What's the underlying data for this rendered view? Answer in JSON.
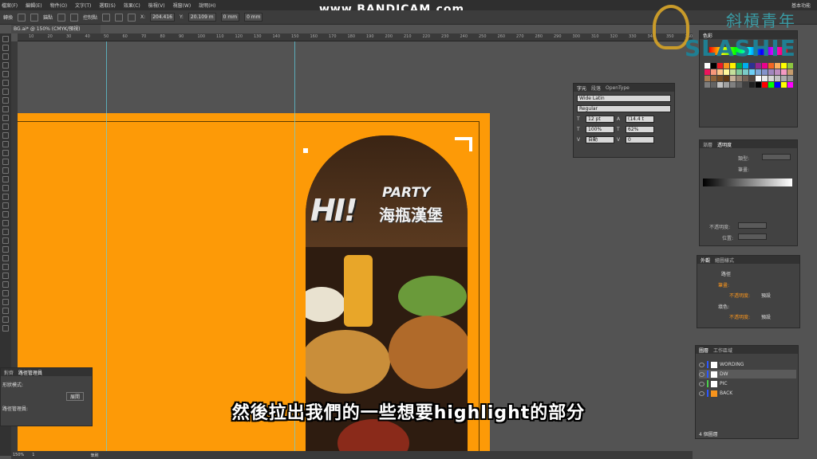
{
  "menu": [
    "檔案(F)",
    "編輯(E)",
    "物件(O)",
    "文字(T)",
    "選取(S)",
    "效果(C)",
    "檢視(V)",
    "視窗(W)",
    "說明(H)"
  ],
  "menu_right": "基本功能",
  "control_bar": {
    "transform_label": "轉換",
    "anchor_label": "控制點",
    "handle_label": "錨點",
    "x_label": "X:",
    "x_value": "204.416",
    "y_label": "Y:",
    "y_value": "20.109 m",
    "w_value": "0 mm",
    "h_value": "0 mm"
  },
  "watermark": "www.BANDICAM.com",
  "doc_tab": "BG.ai* @ 150% (CMYK/預視)",
  "ruler_ticks": [
    "10",
    "20",
    "30",
    "40",
    "50",
    "60",
    "70",
    "80",
    "90",
    "100",
    "110",
    "120",
    "130",
    "140",
    "150",
    "160",
    "170",
    "180",
    "190",
    "200",
    "210",
    "220",
    "230",
    "240",
    "250",
    "260",
    "270",
    "280",
    "290",
    "300",
    "310",
    "320",
    "330",
    "340",
    "350",
    "360",
    "370",
    "380"
  ],
  "poster": {
    "hi": "HI!",
    "party": "PARTY",
    "chinese": "海瓶漢堡"
  },
  "subtitle": "然後拉出我們的一些想要highlight的部分",
  "character_panel": {
    "tabs": [
      "字元",
      "段落",
      "OpenType"
    ],
    "font": "Wide Latin",
    "style": "Regular",
    "size": "12 pt",
    "leading": "(14.4 t",
    "h_scale": "100%",
    "v_scale": "62%",
    "kerning": "自動",
    "tracking": "0"
  },
  "swatch_panel": {
    "tabs": [
      "色彩"
    ],
    "colors": [
      "#ffffff",
      "#000000",
      "#ed1c24",
      "#f7941d",
      "#fff200",
      "#00a651",
      "#00aeef",
      "#2e3192",
      "#92278f",
      "#ec008c",
      "#f26522",
      "#fbaf5d",
      "#ffff00",
      "#8dc63f",
      "#ed145b",
      "#f7977a",
      "#fdc689",
      "#fff799",
      "#c4df9b",
      "#82ca9c",
      "#7accc8",
      "#6dcff6",
      "#7da7d8",
      "#8493ca",
      "#a186be",
      "#bd8cbf",
      "#f49ac2",
      "#c69c6d",
      "#a67c52",
      "#8c6239",
      "#754c24",
      "#603913",
      "#c7b299",
      "#998675",
      "#736357",
      "#534741",
      "#ffffff",
      "#ebebeb",
      "#d7d7d7",
      "#c2c2c2",
      "#acacac",
      "#959595",
      "#7d7d7d",
      "#636363",
      "#c0c0c0",
      "#a0a0a0",
      "#808080",
      "#606060",
      "#404040",
      "#202020",
      "#000000",
      "#ff0000",
      "#00ff00",
      "#0000ff",
      "#ffff00",
      "#ff00ff"
    ]
  },
  "stroke_panel": {
    "tabs": [
      "漸層",
      "透明度"
    ],
    "labels": {
      "type": "類型:",
      "stroke": "筆畫:",
      "opacity": "不透明度:",
      "position": "位置:"
    }
  },
  "appearance_panel": {
    "tabs": [
      "外觀",
      "繪圖樣式"
    ],
    "path": "路徑",
    "stroke_label": "筆畫:",
    "opacity_label": "不透明度:",
    "opacity_value": "預設",
    "fill_label": "填色:",
    "opacity2_label": "不透明度:",
    "opacity2_value": "預設"
  },
  "layers_panel": {
    "tabs": [
      "圖層",
      "工作區域"
    ],
    "layers": [
      {
        "name": "WORDING",
        "color": "#2c58ff",
        "selected": false
      },
      {
        "name": "DW",
        "color": "#2c58ff",
        "selected": true
      },
      {
        "name": "PIC",
        "color": "#4cce4c",
        "selected": false
      },
      {
        "name": "BACK",
        "color": "#2c58ff",
        "selected": false
      }
    ],
    "count": "4 個圖層"
  },
  "path_panel": {
    "tabs": [
      "對齊",
      "路徑管理員"
    ],
    "shape_modes": "形狀模式:",
    "expand": "展開",
    "pathfinders": "路徑管理員:"
  },
  "status": {
    "zoom": "150%",
    "page": "1",
    "tool": "筆刷"
  },
  "logo": {
    "cn": "斜槓青年",
    "en": "SLASHIE"
  }
}
